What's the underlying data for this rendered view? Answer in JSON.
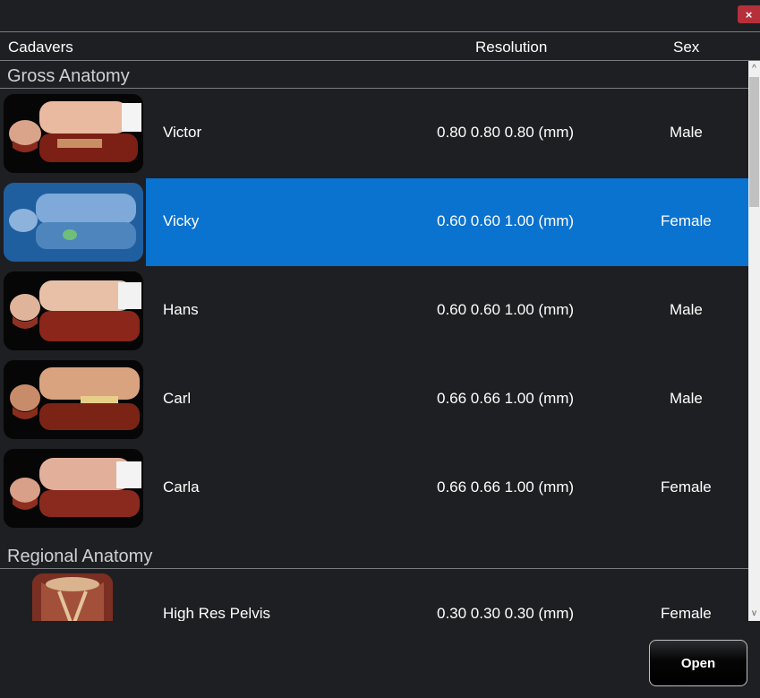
{
  "window": {
    "close_label": "×"
  },
  "header": {
    "col_name": "Cadavers",
    "col_resolution": "Resolution",
    "col_sex": "Sex"
  },
  "sections": [
    {
      "title": "Gross Anatomy"
    },
    {
      "title": "Regional Anatomy"
    }
  ],
  "cadavers": [
    {
      "name": "Victor",
      "resolution": "0.80 0.80 0.80 (mm)",
      "sex": "Male",
      "selected": false
    },
    {
      "name": "Vicky",
      "resolution": "0.60 0.60 1.00 (mm)",
      "sex": "Female",
      "selected": true
    },
    {
      "name": "Hans",
      "resolution": "0.60 0.60 1.00 (mm)",
      "sex": "Male",
      "selected": false
    },
    {
      "name": "Carl",
      "resolution": "0.66 0.66 1.00 (mm)",
      "sex": "Male",
      "selected": false
    },
    {
      "name": "Carla",
      "resolution": "0.66 0.66 1.00 (mm)",
      "sex": "Female",
      "selected": false
    }
  ],
  "regional": [
    {
      "name": "High Res Pelvis",
      "resolution": "0.30 0.30 0.30 (mm)",
      "sex": "Female"
    }
  ],
  "scrollbar": {
    "up_icon": "chevron-up-icon",
    "down_icon": "chevron-down-icon",
    "up_glyph": "^",
    "down_glyph": "v"
  },
  "footer": {
    "open_label": "Open"
  },
  "colors": {
    "selection": "#0a72cf",
    "background": "#1e1f22",
    "close": "#b5303a"
  }
}
